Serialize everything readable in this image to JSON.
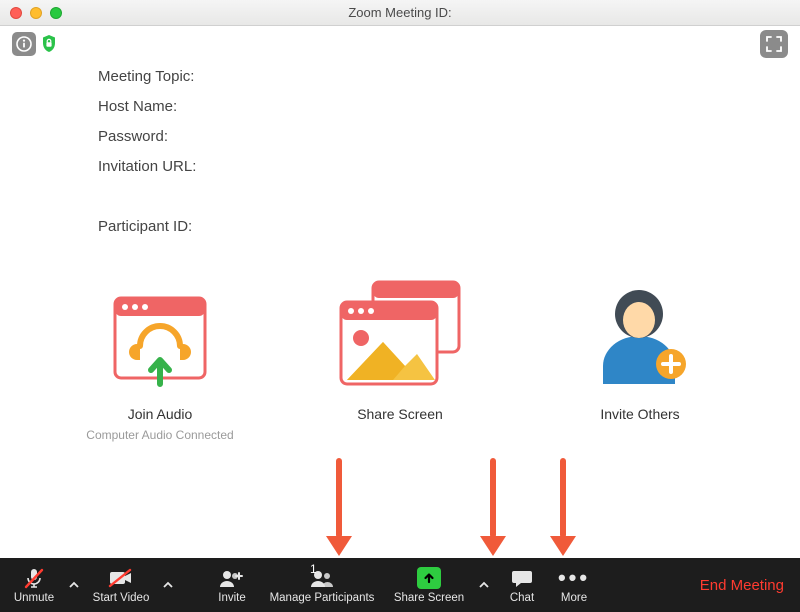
{
  "window": {
    "title": "Zoom Meeting ID:"
  },
  "info": {
    "topic_label": "Meeting Topic:",
    "host_label": "Host Name:",
    "password_label": "Password:",
    "url_label": "Invitation URL:",
    "participant_label": "Participant ID:"
  },
  "tiles": {
    "join_audio": {
      "label": "Join Audio",
      "sub": "Computer Audio Connected"
    },
    "share_screen": {
      "label": "Share Screen"
    },
    "invite_others": {
      "label": "Invite Others"
    }
  },
  "toolbar": {
    "unmute": "Unmute",
    "start_video": "Start Video",
    "invite": "Invite",
    "manage_participants": "Manage Participants",
    "participants_count": "1",
    "share_screen": "Share Screen",
    "chat": "Chat",
    "more": "More",
    "end": "End Meeting"
  }
}
